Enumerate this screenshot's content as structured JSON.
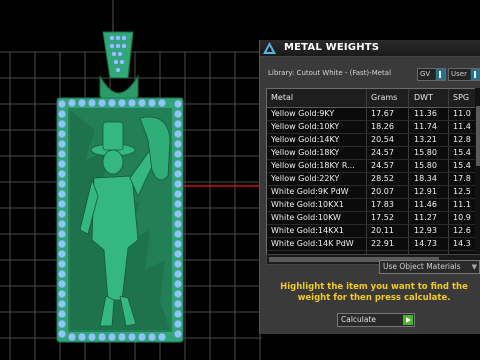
{
  "panel": {
    "title": "METAL WEIGHTS",
    "library_label": "Library: Cutout White - (Fast)-Metal",
    "gv_dropdown": "GV",
    "user_dropdown": "User",
    "columns": [
      "Metal",
      "Grams",
      "DWT",
      "SPG"
    ],
    "rows": [
      [
        "Yellow Gold:9KY",
        "17.67",
        "11.36",
        "11.0"
      ],
      [
        "Yellow Gold:10KY",
        "18.26",
        "11.74",
        "11.4"
      ],
      [
        "Yellow Gold:14KY",
        "20.54",
        "13.21",
        "12.8"
      ],
      [
        "Yellow Gold:18KY",
        "24.57",
        "15.80",
        "15.4"
      ],
      [
        "Yellow Gold:18KY R...",
        "24.57",
        "15.80",
        "15.4"
      ],
      [
        "Yellow Gold:22KY",
        "28.52",
        "18.34",
        "17.8"
      ],
      [
        "White Gold:9K PdW",
        "20.07",
        "12.91",
        "12.5"
      ],
      [
        "White Gold:10KX1",
        "17.83",
        "11.46",
        "11.1"
      ],
      [
        "White Gold:10KW",
        "17.52",
        "11.27",
        "10.9"
      ],
      [
        "White Gold:14KX1",
        "20.11",
        "12.93",
        "12.6"
      ],
      [
        "White Gold:14K PdW",
        "22.91",
        "14.73",
        "14.3"
      ]
    ],
    "use_object_materials": "Use Object Materials",
    "hint": "Highlight the item you want to find the weight for then press calculate.",
    "calculate_button": "Calculate"
  },
  "colors": {
    "viewport_bg": "#000000",
    "grid_line": "#4a4a4a",
    "red_axis": "#c81414",
    "pendant_green": "#2ea974",
    "gem_blue": "#8cc6f2",
    "panel_bg": "#3a3a3a",
    "hint_yellow": "#f2cb22"
  }
}
